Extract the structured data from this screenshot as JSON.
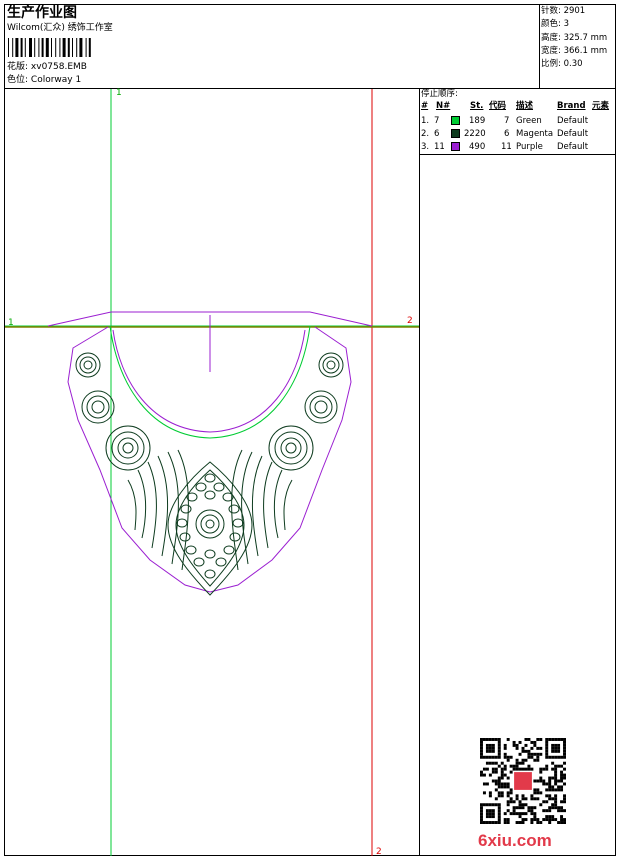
{
  "header": {
    "title": "生产作业图",
    "studio": "Wilcom(汇众) 绣饰工作室",
    "fabric_label": "花版:",
    "fabric_value": "xv0758.EMB",
    "colorway_label": "色位:",
    "colorway_value": "Colorway 1"
  },
  "stats": [
    {
      "label": "针数:",
      "value": "2901"
    },
    {
      "label": "颜色:",
      "value": "3"
    },
    {
      "label": "高度:",
      "value": "325.7 mm"
    },
    {
      "label": "宽度:",
      "value": "366.1 mm"
    },
    {
      "label": "比例:",
      "value": "0.30"
    }
  ],
  "stop_sequence": {
    "title": "停止顺序:",
    "headers": {
      "num": "#",
      "n": "N#",
      "st": "St.",
      "code": "代码",
      "desc": "描述",
      "brand": "Brand",
      "element": "元素"
    },
    "rows": [
      {
        "num": "1.",
        "n": "7",
        "color": "#00cc33",
        "st": "189",
        "code": "7",
        "desc": "Green",
        "brand": "Default"
      },
      {
        "num": "2.",
        "n": "6",
        "color": "#0d3b1e",
        "st": "2220",
        "code": "6",
        "desc": "Magenta",
        "brand": "Default"
      },
      {
        "num": "3.",
        "n": "11",
        "color": "#9b1fd1",
        "st": "490",
        "code": "11",
        "desc": "Purple",
        "brand": "Default"
      }
    ]
  },
  "guides": {
    "green_top": "1",
    "green_left": "1",
    "red_right": "2",
    "red_bottom": "2"
  },
  "watermark": {
    "logo": "6xiu.com"
  },
  "colors": {
    "green_guide": "#00cc33",
    "red_guide": "#dd0000",
    "olive_line": "#808000",
    "outline": "#9b1fd1",
    "stitch": "#0d3b1e"
  }
}
